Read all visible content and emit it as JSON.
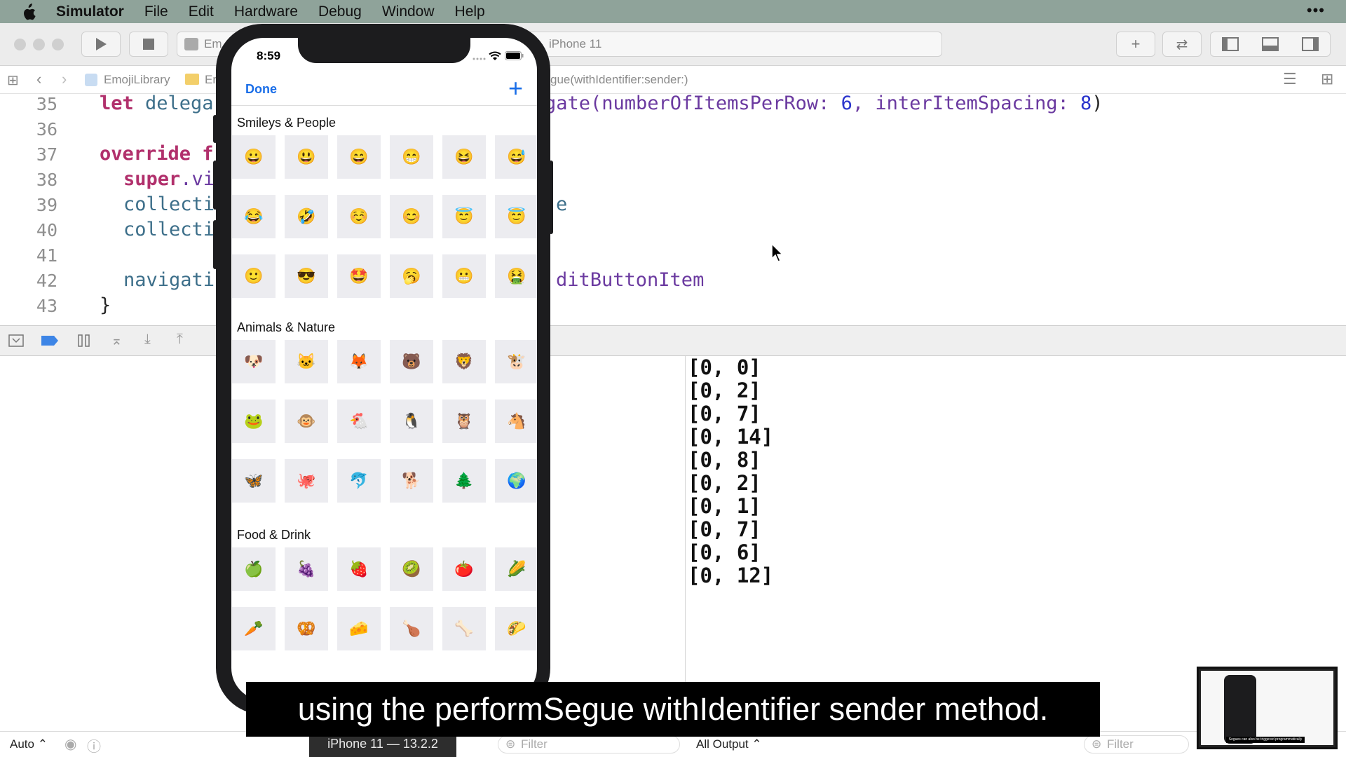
{
  "menubar": {
    "app_name": "Simulator",
    "items": [
      "File",
      "Edit",
      "Hardware",
      "Debug",
      "Window",
      "Help"
    ],
    "overflow": "•••"
  },
  "toolbar": {
    "scheme_left": "Em",
    "scheme_text": "iPhone 11"
  },
  "jumpbar": {
    "project": "EmojiLibrary",
    "folder": "Er",
    "method": "gue(withIdentifier:sender:)"
  },
  "editor": {
    "lines": [
      {
        "num": "35"
      },
      {
        "num": "36"
      },
      {
        "num": "37"
      },
      {
        "num": "38"
      },
      {
        "num": "39"
      },
      {
        "num": "40"
      },
      {
        "num": "41"
      },
      {
        "num": "42"
      },
      {
        "num": "43"
      }
    ],
    "l35a": "let ",
    "l35b": "delega",
    "l35c": "gate(numberOfItemsPerRow: ",
    "l35d": "6",
    "l35e": ", interItemSpacing: ",
    "l35f": "8",
    "l35g": ")",
    "l37a": "override",
    "l37b": " f",
    "l38a": "super",
    "l38b": ".vi",
    "l39a": "collecti",
    "l39b": "e",
    "l40a": "collecti",
    "l42a": "navigati",
    "l42b": "ditButtonItem",
    "l43": "}"
  },
  "phone": {
    "time": "8:59",
    "done_label": "Done",
    "add_label": "+",
    "sections": [
      {
        "title": "Smileys & People",
        "rows": [
          [
            "😀",
            "😃",
            "😄",
            "😁",
            "😆",
            "😅"
          ],
          [
            "😂",
            "🤣",
            "☺️",
            "😊",
            "😇",
            "😇"
          ],
          [
            "🙂",
            "😎",
            "🤩",
            "🥱",
            "😬",
            "🤮"
          ]
        ]
      },
      {
        "title": "Animals & Nature",
        "rows": [
          [
            "🐶",
            "🐱",
            "🦊",
            "🐻",
            "🦁",
            "🐮"
          ],
          [
            "🐸",
            "🐵",
            "🐔",
            "🐧",
            "🦉",
            "🐴"
          ],
          [
            "🦋",
            "🐙",
            "🐬",
            "🐕",
            "🌲",
            "🌍"
          ]
        ]
      },
      {
        "title": "Food & Drink",
        "rows": [
          [
            "🍏",
            "🍇",
            "🍓",
            "🥝",
            "🍅",
            "🌽"
          ],
          [
            "🥕",
            "🥨",
            "🧀",
            "🍗",
            "🦴",
            "🌮"
          ]
        ]
      }
    ]
  },
  "console": {
    "output": [
      "[0, 0]",
      "[0, 2]",
      "[0, 7]",
      "[0, 14]",
      "[0, 8]",
      "[0, 2]",
      "[0, 1]",
      "[0, 7]",
      "[0, 6]",
      "[0, 12]"
    ],
    "filter_placeholder": "Filter",
    "output_selector": "All Output ⌃"
  },
  "variables": {
    "auto_label": "Auto ⌃",
    "filter_placeholder": "Filter"
  },
  "device_label": "iPhone 11 — 13.2.2",
  "caption": "using the performSegue withIdentifier sender method.",
  "thumbnail_caption": "Segues can also be triggered programmatically"
}
